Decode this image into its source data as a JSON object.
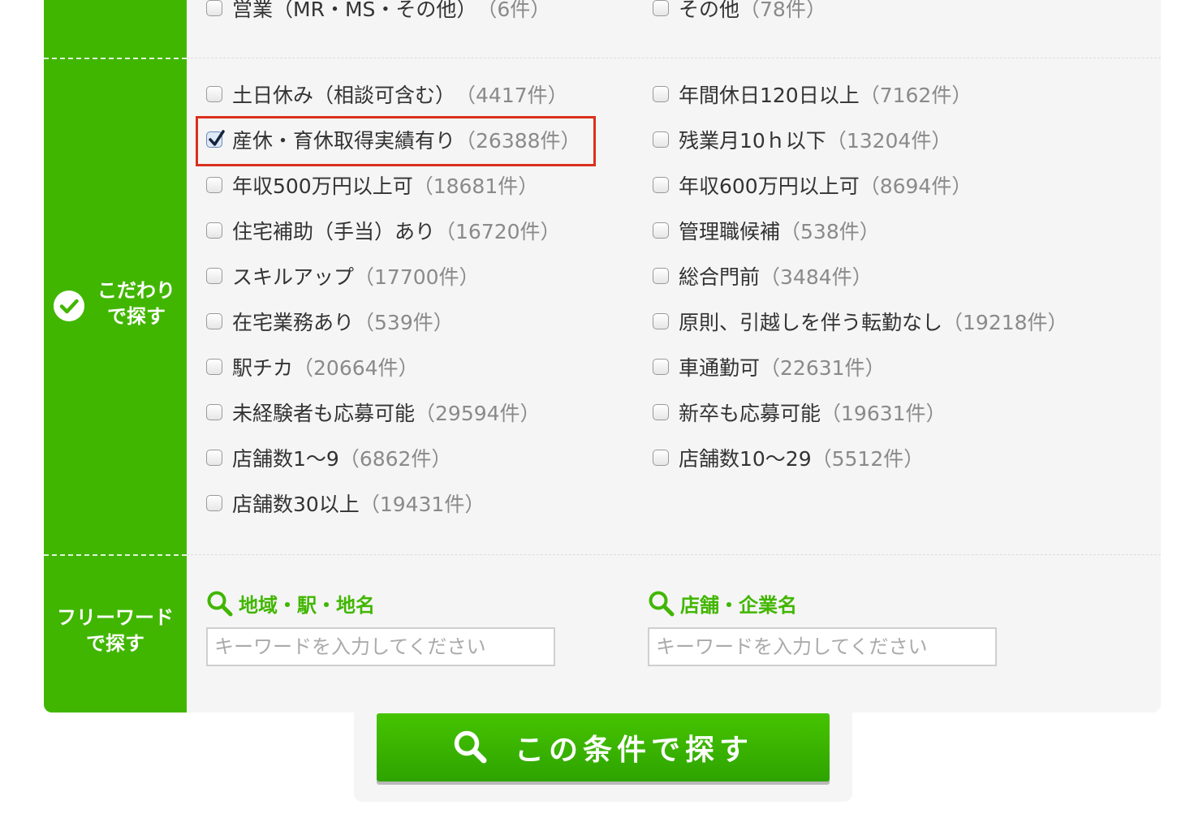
{
  "top_row": [
    {
      "label": "営業（MR・MS・その他）",
      "count": "（6件）",
      "checked": false
    },
    {
      "label": "その他",
      "count": "（78件）",
      "checked": false
    }
  ],
  "kodawari": {
    "section_label_line1": "こだわり",
    "section_label_line2": "で探す",
    "left": [
      {
        "label": "土日休み（相談可含む）",
        "count": "（4417件）",
        "checked": false
      },
      {
        "label": "産休・育休取得実績有り",
        "count": "（26388件）",
        "checked": true
      },
      {
        "label": "年収500万円以上可",
        "count": "（18681件）",
        "checked": false
      },
      {
        "label": "住宅補助（手当）あり",
        "count": "（16720件）",
        "checked": false
      },
      {
        "label": "スキルアップ",
        "count": "（17700件）",
        "checked": false
      },
      {
        "label": "在宅業務あり",
        "count": "（539件）",
        "checked": false
      },
      {
        "label": "駅チカ",
        "count": "（20664件）",
        "checked": false
      },
      {
        "label": "未経験者も応募可能",
        "count": "（29594件）",
        "checked": false
      },
      {
        "label": "店舗数1〜9",
        "count": "（6862件）",
        "checked": false
      },
      {
        "label": "店舗数30以上",
        "count": "（19431件）",
        "checked": false
      }
    ],
    "right": [
      {
        "label": "年間休日120日以上",
        "count": "（7162件）",
        "checked": false
      },
      {
        "label": "残業月10ｈ以下",
        "count": "（13204件）",
        "checked": false
      },
      {
        "label": "年収600万円以上可",
        "count": "（8694件）",
        "checked": false
      },
      {
        "label": "管理職候補",
        "count": "（538件）",
        "checked": false
      },
      {
        "label": "総合門前",
        "count": "（3484件）",
        "checked": false
      },
      {
        "label": "原則、引越しを伴う転勤なし",
        "count": "（19218件）",
        "checked": false
      },
      {
        "label": "車通勤可",
        "count": "（22631件）",
        "checked": false
      },
      {
        "label": "新卒も応募可能",
        "count": "（19631件）",
        "checked": false
      },
      {
        "label": "店舗数10〜29",
        "count": "（5512件）",
        "checked": false
      }
    ]
  },
  "freeword": {
    "section_label_line1": "フリーワード",
    "section_label_line2": "で探す",
    "area_label": "地域・駅・地名",
    "area_placeholder": "キーワードを入力してください",
    "store_label": "店舗・企業名",
    "store_placeholder": "キーワードを入力してください"
  },
  "submit": {
    "label": "この条件で探す"
  },
  "colors": {
    "brand_green": "#41b600",
    "highlight_red": "#d9301c"
  }
}
